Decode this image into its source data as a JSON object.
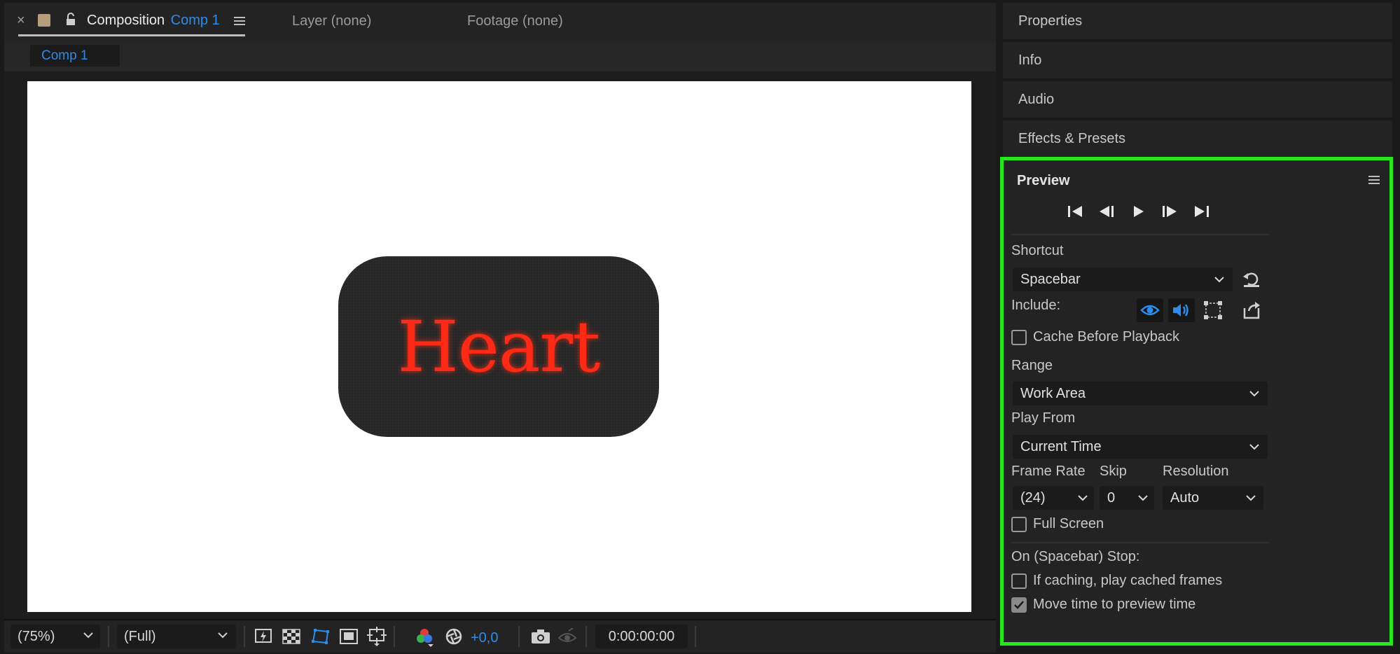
{
  "composition": {
    "close_symbol": "×",
    "tab_name": "Composition",
    "comp_name": "Comp 1",
    "layer_tab": "Layer (none)",
    "footage_tab": "Footage (none)",
    "subtab": "Comp 1"
  },
  "canvas": {
    "text": "Heart",
    "text_color": "#ff2a16"
  },
  "footer": {
    "zoom": "(75%)",
    "resolution": "(Full)",
    "exposure": "+0,0",
    "timecode": "0:00:00:00"
  },
  "side_panels": {
    "properties": "Properties",
    "info": "Info",
    "audio": "Audio",
    "effects": "Effects & Presets"
  },
  "preview": {
    "title": "Preview",
    "shortcut_label": "Shortcut",
    "shortcut_value": "Spacebar",
    "include_label": "Include:",
    "cache_before_playback": "Cache Before Playback",
    "range_label": "Range",
    "range_value": "Work Area",
    "play_from_label": "Play From",
    "play_from_value": "Current Time",
    "frame_rate_label": "Frame Rate",
    "frame_rate_value": "(24)",
    "skip_label": "Skip",
    "skip_value": "0",
    "resolution_label": "Resolution",
    "resolution_value": "Auto",
    "full_screen": "Full Screen",
    "on_stop_label": "On (Spacebar) Stop:",
    "if_caching": "If caching, play cached frames",
    "move_time": "Move time to preview time",
    "checks": {
      "cache_before_playback": false,
      "full_screen": false,
      "if_caching": false,
      "move_time": true
    }
  },
  "colors": {
    "accent_blue": "#2d8ceb",
    "highlight_border": "#23e81c"
  }
}
